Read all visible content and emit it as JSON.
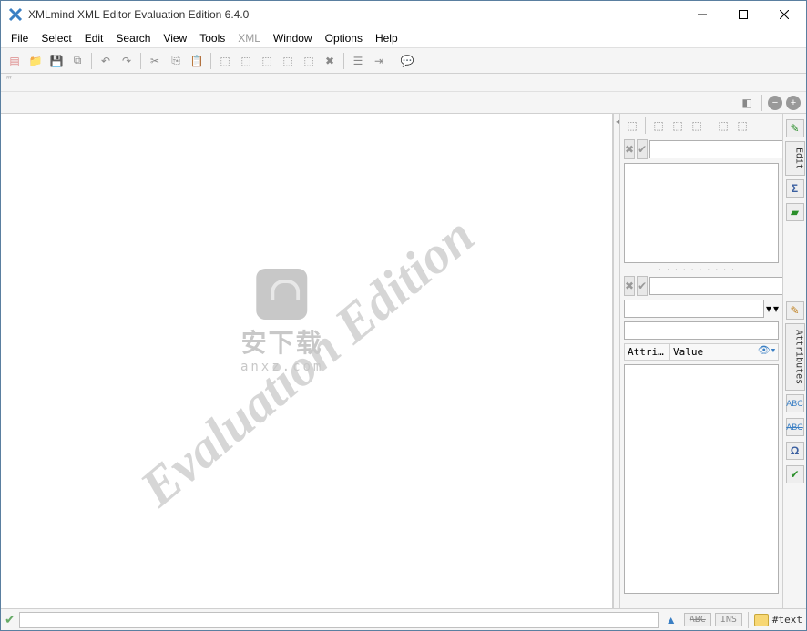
{
  "title": "XMLmind XML Editor Evaluation Edition 6.4.0",
  "menu": [
    "File",
    "Select",
    "Edit",
    "Search",
    "View",
    "Tools",
    "XML",
    "Window",
    "Options",
    "Help"
  ],
  "menu_disabled": [
    6
  ],
  "watermark": "Evaluation Edition",
  "centermark": {
    "cn": "安下载",
    "en": "anxz.com"
  },
  "sidetabs": {
    "edit": "Edit",
    "attrs": "Attributes"
  },
  "attr_table": {
    "col1": "Attri…",
    "col2": "Value"
  },
  "status": {
    "ins": "INS",
    "abc": "ABC",
    "text": "#text"
  }
}
